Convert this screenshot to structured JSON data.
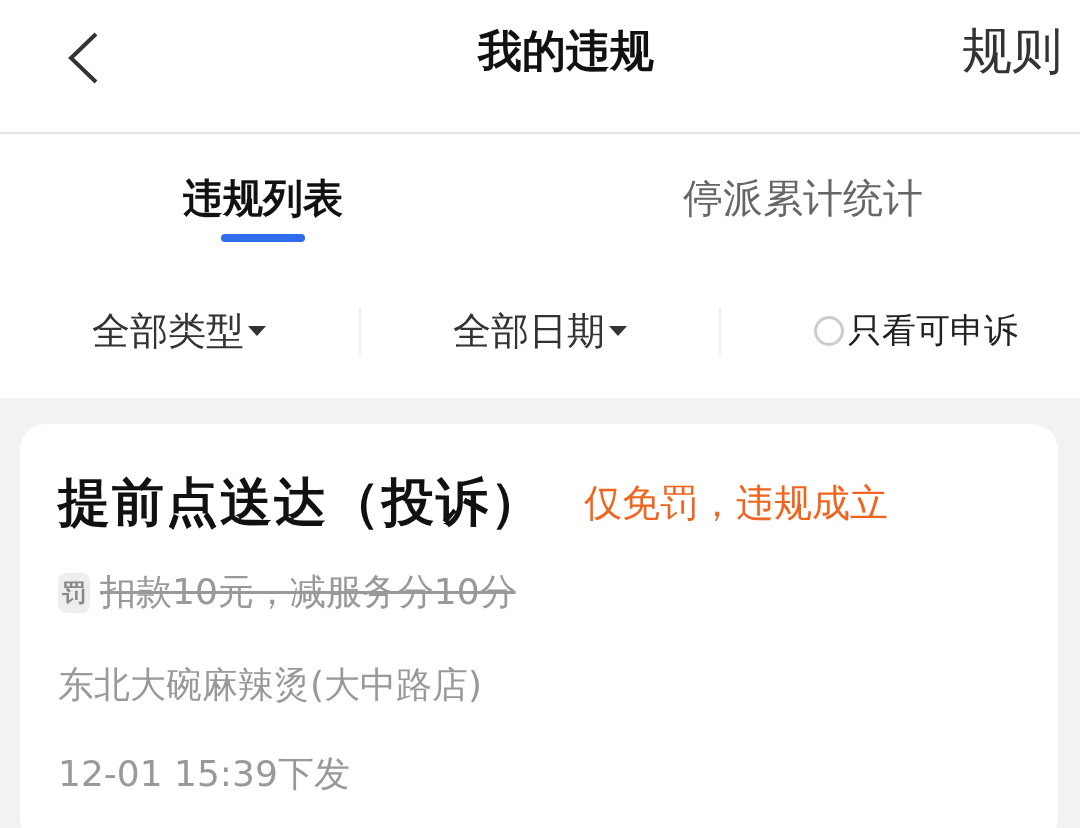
{
  "header": {
    "title": "我的违规",
    "action": "规则"
  },
  "tabs": [
    {
      "label": "违规列表",
      "selected": true
    },
    {
      "label": "停派累计统计",
      "selected": false
    }
  ],
  "filters": [
    {
      "kind": "dropdown",
      "label": "全部类型"
    },
    {
      "kind": "dropdown",
      "label": "全部日期"
    },
    {
      "kind": "checkbox",
      "label": "只看可申诉",
      "checked": false
    }
  ],
  "violations": [
    {
      "title": "提前点送达（投诉）",
      "status": "仅免罚，违规成立",
      "badge": "罚",
      "penalty": "扣款10元，减服务分10分",
      "penalty_waived": true,
      "store": "东北大碗麻辣烫(大中路店)",
      "time": "12-01 15:39下发"
    }
  ]
}
